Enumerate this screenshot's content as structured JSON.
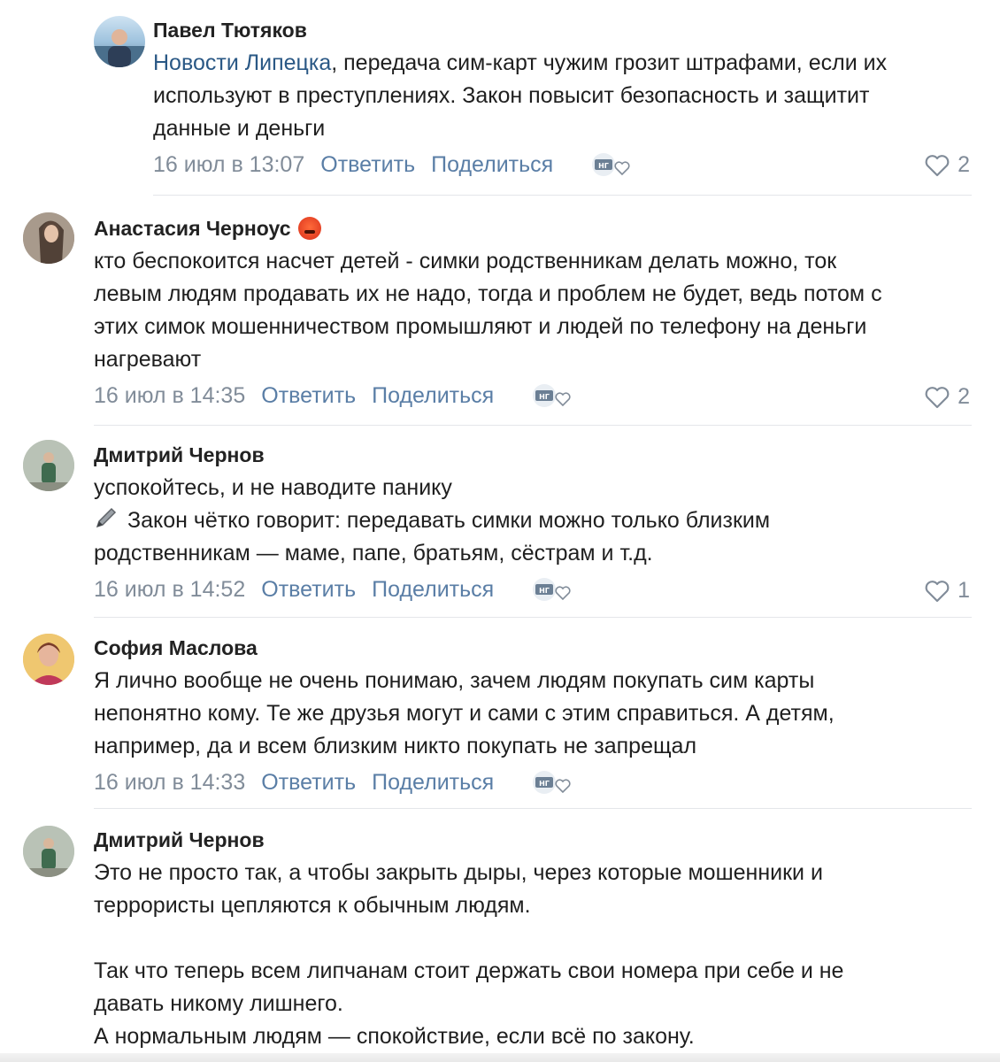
{
  "comments": [
    {
      "author": "Павел Тютяков",
      "mention": "Новости Липецка",
      "text_after_mention": ", передача сим-карт чужим грозит штрафами, если их\nиспользуют в преступлениях. Закон повысит безопасность и защитит\nданные и деньги",
      "date": "16 июл в 13:07",
      "reply": "Ответить",
      "share": "Поделиться",
      "likes": "2"
    },
    {
      "author": "Анастасия Черноус",
      "text": "кто беспокоится насчет детей - симки родственникам делать можно, ток\nлевым людям продавать их не надо, тогда и проблем не будет, ведь потом с\nэтих симок мошенничеством промышляют и людей по телефону на деньги\nнагревают",
      "date": "16 июл в 14:35",
      "reply": "Ответить",
      "share": "Поделиться",
      "likes": "2"
    },
    {
      "author": "Дмитрий Чернов",
      "text_line1": "успокойтесь, и не наводите панику",
      "text_rest": "Закон чётко говорит: передавать симки можно только близким\nродственникам — маме, папе, братьям, сёстрам и т.д.",
      "date": "16 июл в 14:52",
      "reply": "Ответить",
      "share": "Поделиться",
      "likes": "1"
    },
    {
      "author": "София Маслова",
      "text": "Я лично вообще не очень понимаю, зачем людям покупать сим карты\nнепонятно кому. Те же друзья могут и сами с этим справиться. А детям,\nнапример, да и всем близким никто покупать не запрещал",
      "date": "16 июл в 14:33",
      "reply": "Ответить",
      "share": "Поделиться"
    },
    {
      "author": "Дмитрий Чернов",
      "text": "Это не просто так, а чтобы закрыть дыры, через которые мошенники и\nтеррористы цепляются к обычным людям.\n\nТак что теперь всем липчанам стоит держать свои номера при себе и не\nдавать никому лишнего.\nА нормальным людям — спокойствие, если всё по закону."
    }
  ],
  "reaction_badge": "НГ",
  "colors": {
    "link": "#2a5885",
    "action": "#5a7ea6",
    "meta": "#818c99",
    "divider": "#e4e6ea"
  }
}
